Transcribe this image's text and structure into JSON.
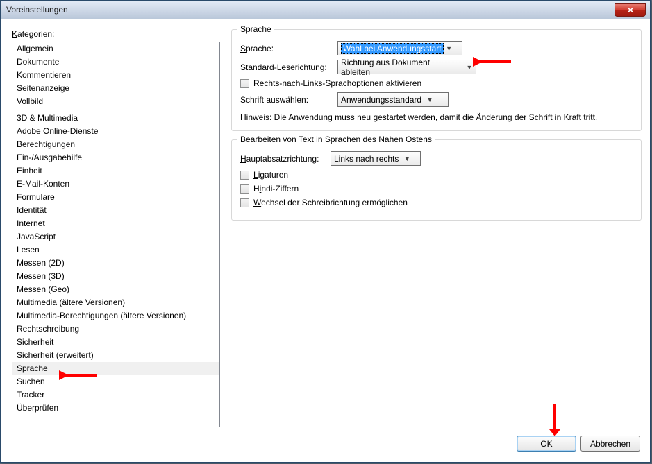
{
  "window": {
    "title": "Voreinstellungen"
  },
  "left": {
    "label": "Kategorien:",
    "group1": [
      "Allgemein",
      "Dokumente",
      "Kommentieren",
      "Seitenanzeige",
      "Vollbild"
    ],
    "group2": [
      "3D & Multimedia",
      "Adobe Online-Dienste",
      "Berechtigungen",
      "Ein-/Ausgabehilfe",
      "Einheit",
      "E-Mail-Konten",
      "Formulare",
      "Identität",
      "Internet",
      "JavaScript",
      "Lesen",
      "Messen (2D)",
      "Messen (3D)",
      "Messen (Geo)",
      "Multimedia (ältere Versionen)",
      "Multimedia-Berechtigungen (ältere Versionen)",
      "Rechtschreibung",
      "Sicherheit",
      "Sicherheit (erweitert)",
      "Sprache",
      "Suchen",
      "Tracker",
      "Überprüfen"
    ],
    "selected": "Sprache"
  },
  "lang_group": {
    "title": "Sprache",
    "language_label": "Sprache:",
    "language_value": "Wahl bei Anwendungsstart",
    "reading_label": "Standard-Leserichtung:",
    "reading_value": "Richtung aus Dokument ableiten",
    "rtl_checkbox": "Rechts-nach-Links-Sprachoptionen aktivieren",
    "font_label": "Schrift auswählen:",
    "font_value": "Anwendungsstandard",
    "note": "Hinweis: Die Anwendung muss neu gestartet werden, damit die Änderung der Schrift in Kraft tritt."
  },
  "me_group": {
    "title": "Bearbeiten von Text in Sprachen des Nahen Ostens",
    "para_label": "Hauptabsatzrichtung:",
    "para_value": "Links nach rechts",
    "ligatures": "Ligaturen",
    "hindi": "Hindi-Ziffern",
    "switch": "Wechsel der Schreibrichtung ermöglichen"
  },
  "footer": {
    "ok": "OK",
    "cancel": "Abbrechen"
  }
}
